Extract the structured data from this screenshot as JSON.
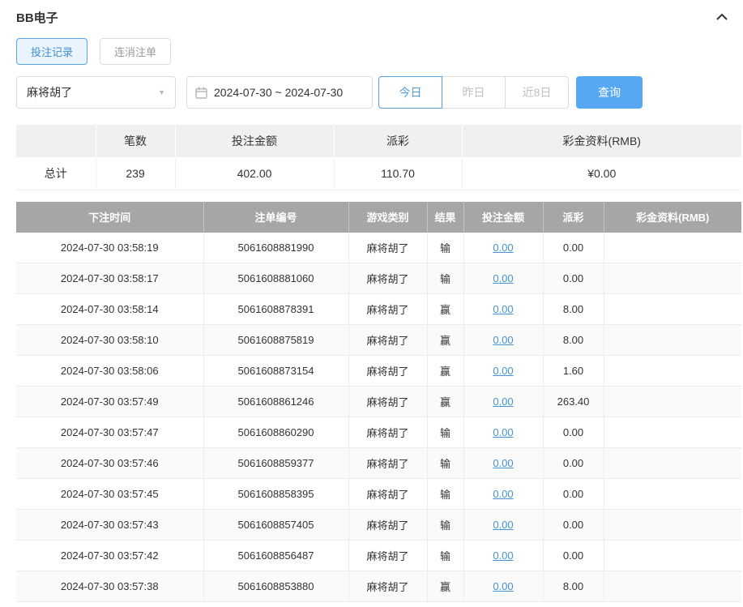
{
  "header": {
    "title": "BB电子"
  },
  "tabs": [
    {
      "label": "投注记录",
      "active": true
    },
    {
      "label": "连消注单",
      "active": false
    }
  ],
  "filters": {
    "game_select": {
      "value": "麻将胡了"
    },
    "date_range": "2024-07-30 ~ 2024-07-30",
    "quick_buttons": [
      {
        "label": "今日",
        "active": true
      },
      {
        "label": "昨日",
        "active": false
      },
      {
        "label": "近8日",
        "active": false
      }
    ],
    "search_label": "查询"
  },
  "summary": {
    "headers": [
      "",
      "笔数",
      "投注金额",
      "派彩",
      "彩金资料(RMB)"
    ],
    "row": {
      "label": "总计",
      "count": "239",
      "bet_amount": "402.00",
      "payout": "110.70",
      "bonus": "¥0.00"
    }
  },
  "table": {
    "headers": [
      "下注时间",
      "注单编号",
      "游戏类别",
      "结果",
      "投注金额",
      "派彩",
      "彩金资料(RMB)"
    ],
    "rows": [
      {
        "time": "2024-07-30 03:58:19",
        "order_id": "5061608881990",
        "game": "麻将胡了",
        "result": "输",
        "bet": "0.00",
        "payout": "0.00",
        "bonus": ""
      },
      {
        "time": "2024-07-30 03:58:17",
        "order_id": "5061608881060",
        "game": "麻将胡了",
        "result": "输",
        "bet": "0.00",
        "payout": "0.00",
        "bonus": ""
      },
      {
        "time": "2024-07-30 03:58:14",
        "order_id": "5061608878391",
        "game": "麻将胡了",
        "result": "赢",
        "bet": "0.00",
        "payout": "8.00",
        "bonus": ""
      },
      {
        "time": "2024-07-30 03:58:10",
        "order_id": "5061608875819",
        "game": "麻将胡了",
        "result": "赢",
        "bet": "0.00",
        "payout": "8.00",
        "bonus": ""
      },
      {
        "time": "2024-07-30 03:58:06",
        "order_id": "5061608873154",
        "game": "麻将胡了",
        "result": "赢",
        "bet": "0.00",
        "payout": "1.60",
        "bonus": ""
      },
      {
        "time": "2024-07-30 03:57:49",
        "order_id": "5061608861246",
        "game": "麻将胡了",
        "result": "赢",
        "bet": "0.00",
        "payout": "263.40",
        "bonus": ""
      },
      {
        "time": "2024-07-30 03:57:47",
        "order_id": "5061608860290",
        "game": "麻将胡了",
        "result": "输",
        "bet": "0.00",
        "payout": "0.00",
        "bonus": ""
      },
      {
        "time": "2024-07-30 03:57:46",
        "order_id": "5061608859377",
        "game": "麻将胡了",
        "result": "输",
        "bet": "0.00",
        "payout": "0.00",
        "bonus": ""
      },
      {
        "time": "2024-07-30 03:57:45",
        "order_id": "5061608858395",
        "game": "麻将胡了",
        "result": "输",
        "bet": "0.00",
        "payout": "0.00",
        "bonus": ""
      },
      {
        "time": "2024-07-30 03:57:43",
        "order_id": "5061608857405",
        "game": "麻将胡了",
        "result": "输",
        "bet": "0.00",
        "payout": "0.00",
        "bonus": ""
      },
      {
        "time": "2024-07-30 03:57:42",
        "order_id": "5061608856487",
        "game": "麻将胡了",
        "result": "输",
        "bet": "0.00",
        "payout": "0.00",
        "bonus": ""
      },
      {
        "time": "2024-07-30 03:57:38",
        "order_id": "5061608853880",
        "game": "麻将胡了",
        "result": "赢",
        "bet": "0.00",
        "payout": "8.00",
        "bonus": ""
      }
    ]
  },
  "colors": {
    "accent_blue": "#57a7f2",
    "active_border_blue": "#53a0e0",
    "tab_active_bg": "#e9f4fe",
    "tab_active_text": "#3f8ecd",
    "link_blue": "#4493d6",
    "table_header_bg": "#a6a6a6",
    "summary_header_bg": "#f0f0f0",
    "row_border": "#ececec"
  }
}
